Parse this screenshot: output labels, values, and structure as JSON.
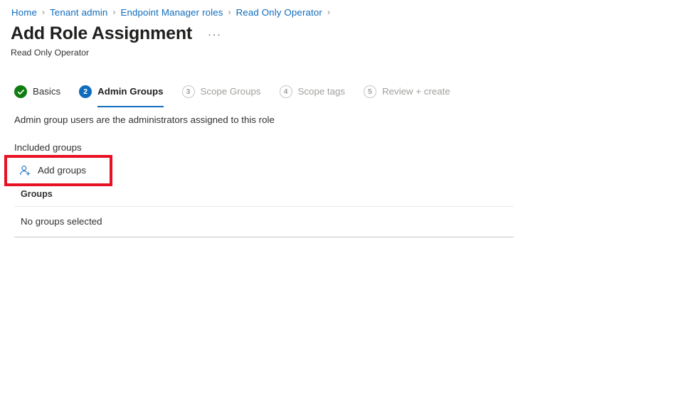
{
  "breadcrumb": {
    "separator": "›",
    "items": [
      {
        "label": "Home"
      },
      {
        "label": "Tenant admin"
      },
      {
        "label": "Endpoint Manager roles"
      },
      {
        "label": "Read Only Operator"
      }
    ],
    "trailing_separator": "›"
  },
  "header": {
    "title": "Add Role Assignment",
    "more_actions": "···",
    "subtitle": "Read Only Operator"
  },
  "wizard": {
    "steps": [
      {
        "badge": "✓",
        "label": "Basics",
        "state": "done"
      },
      {
        "badge": "2",
        "label": "Admin Groups",
        "state": "current"
      },
      {
        "badge": "3",
        "label": "Scope Groups",
        "state": "pending"
      },
      {
        "badge": "4",
        "label": "Scope tags",
        "state": "pending"
      },
      {
        "badge": "5",
        "label": "Review + create",
        "state": "pending"
      }
    ]
  },
  "main": {
    "description": "Admin group users are the administrators assigned to this role",
    "included_groups_label": "Included groups",
    "add_groups_button": {
      "label": "Add groups",
      "icon": "person-add-icon"
    },
    "groups_table": {
      "columns": [
        "Groups"
      ],
      "rows": [
        [
          "No groups selected"
        ]
      ]
    }
  },
  "annotation": {
    "type": "highlight-rectangle",
    "target": "add-groups-button",
    "color": "#e81123"
  },
  "colors": {
    "link": "#0f6cbd",
    "accent": "#0f6cbd",
    "success": "#107c10",
    "text": "#323130",
    "muted": "#a19f9d",
    "annotation": "#e81123"
  }
}
